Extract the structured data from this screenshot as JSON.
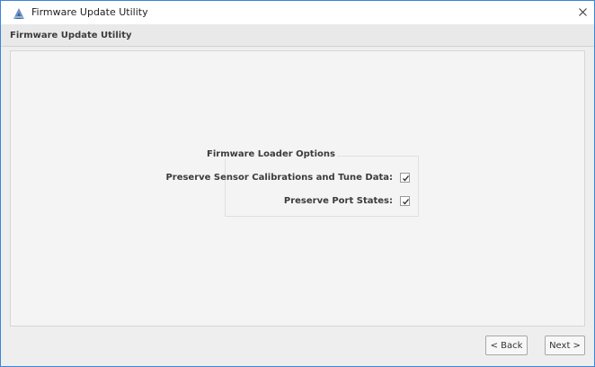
{
  "window": {
    "title": "Firmware Update Utility",
    "close_label": "✕"
  },
  "header": {
    "title": "Firmware Update Utility"
  },
  "options": {
    "group_title": "Firmware Loader Options",
    "items": [
      {
        "label": "Preserve Sensor Calibrations and Tune Data:",
        "checked": true
      },
      {
        "label": "Preserve Port States:",
        "checked": true
      }
    ]
  },
  "buttons": {
    "back": "< Back",
    "next": "Next >"
  },
  "colors": {
    "window_border": "#3a86d8",
    "background": "#eeeeee"
  }
}
